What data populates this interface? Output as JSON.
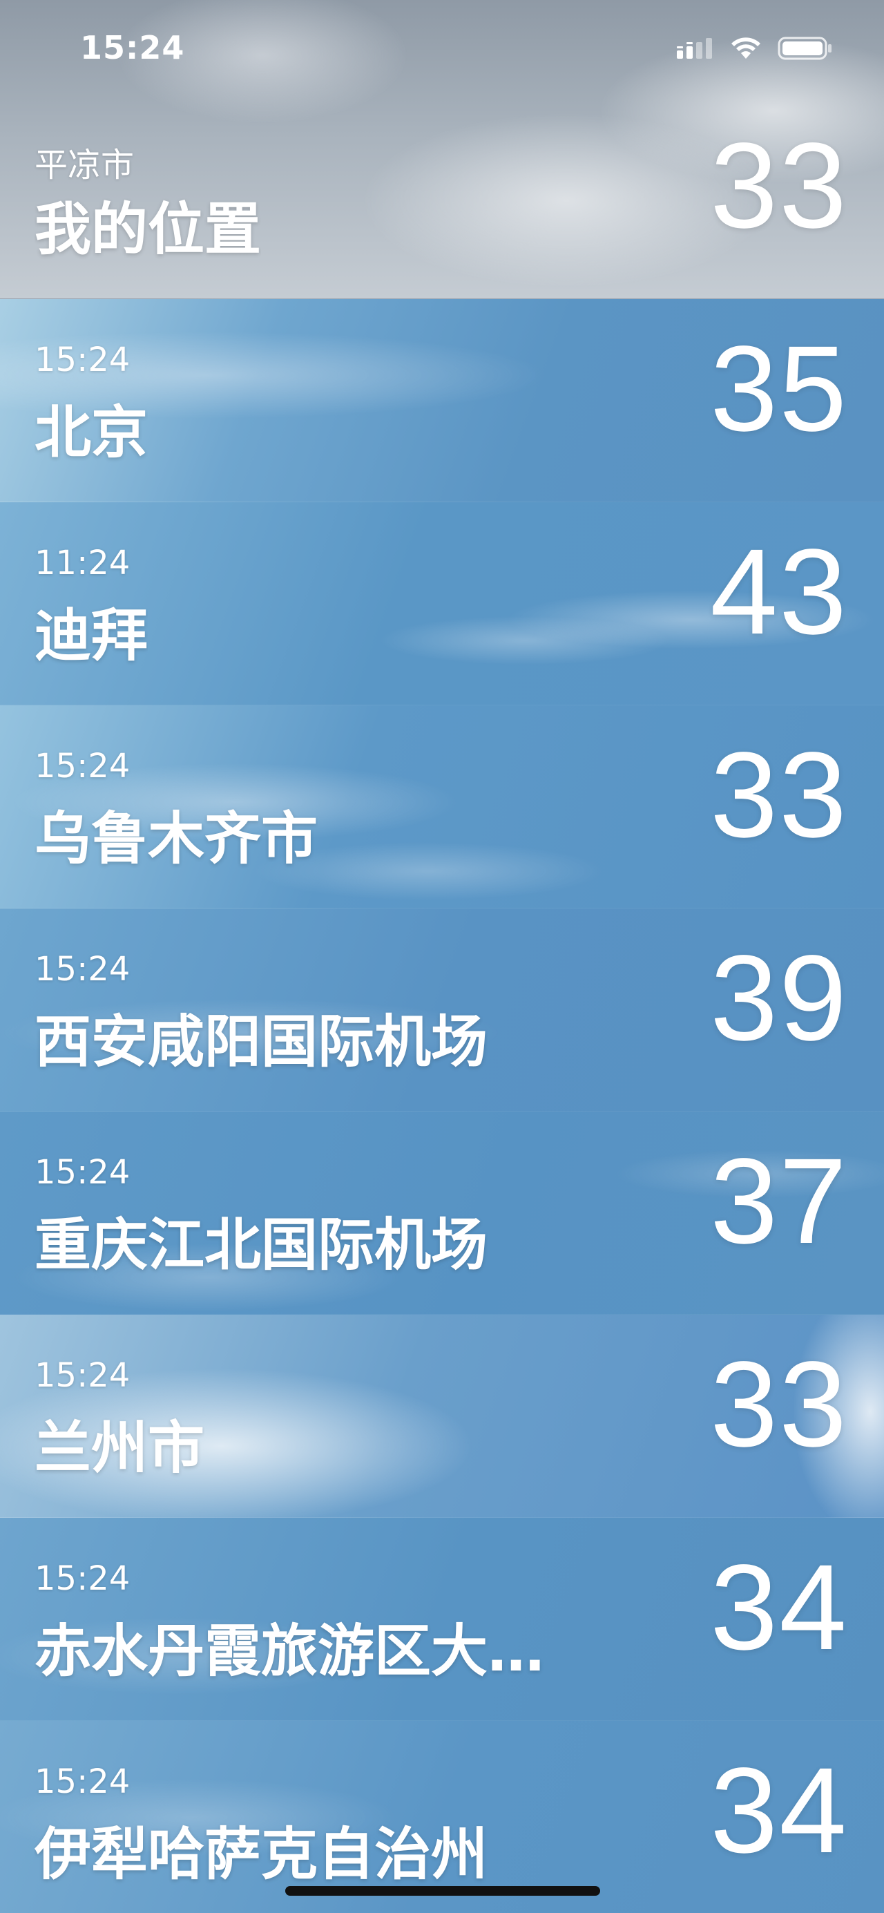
{
  "status_bar": {
    "time": "15:24",
    "icons": [
      "cellular-signal-icon",
      "wifi-icon",
      "battery-icon"
    ]
  },
  "locations": [
    {
      "subtitle": "平凉市",
      "title": "我的位置",
      "temp": "33"
    },
    {
      "subtitle": "15:24",
      "title": "北京",
      "temp": "35"
    },
    {
      "subtitle": "11:24",
      "title": "迪拜",
      "temp": "43"
    },
    {
      "subtitle": "15:24",
      "title": "乌鲁木齐市",
      "temp": "33"
    },
    {
      "subtitle": "15:24",
      "title": "西安咸阳国际机场",
      "temp": "39"
    },
    {
      "subtitle": "15:24",
      "title": "重庆江北国际机场",
      "temp": "37"
    },
    {
      "subtitle": "15:24",
      "title": "兰州市",
      "temp": "33"
    },
    {
      "subtitle": "15:24",
      "title": "赤水丹霞旅游区大…",
      "temp": "34"
    },
    {
      "subtitle": "15:24",
      "title": "伊犁哈萨克自治州",
      "temp": "34"
    }
  ],
  "colors": {
    "text": "#ffffff",
    "sky_blue": "#5a93c3",
    "cloud_gray": "#a9b3bd",
    "home_indicator": "#111111"
  }
}
